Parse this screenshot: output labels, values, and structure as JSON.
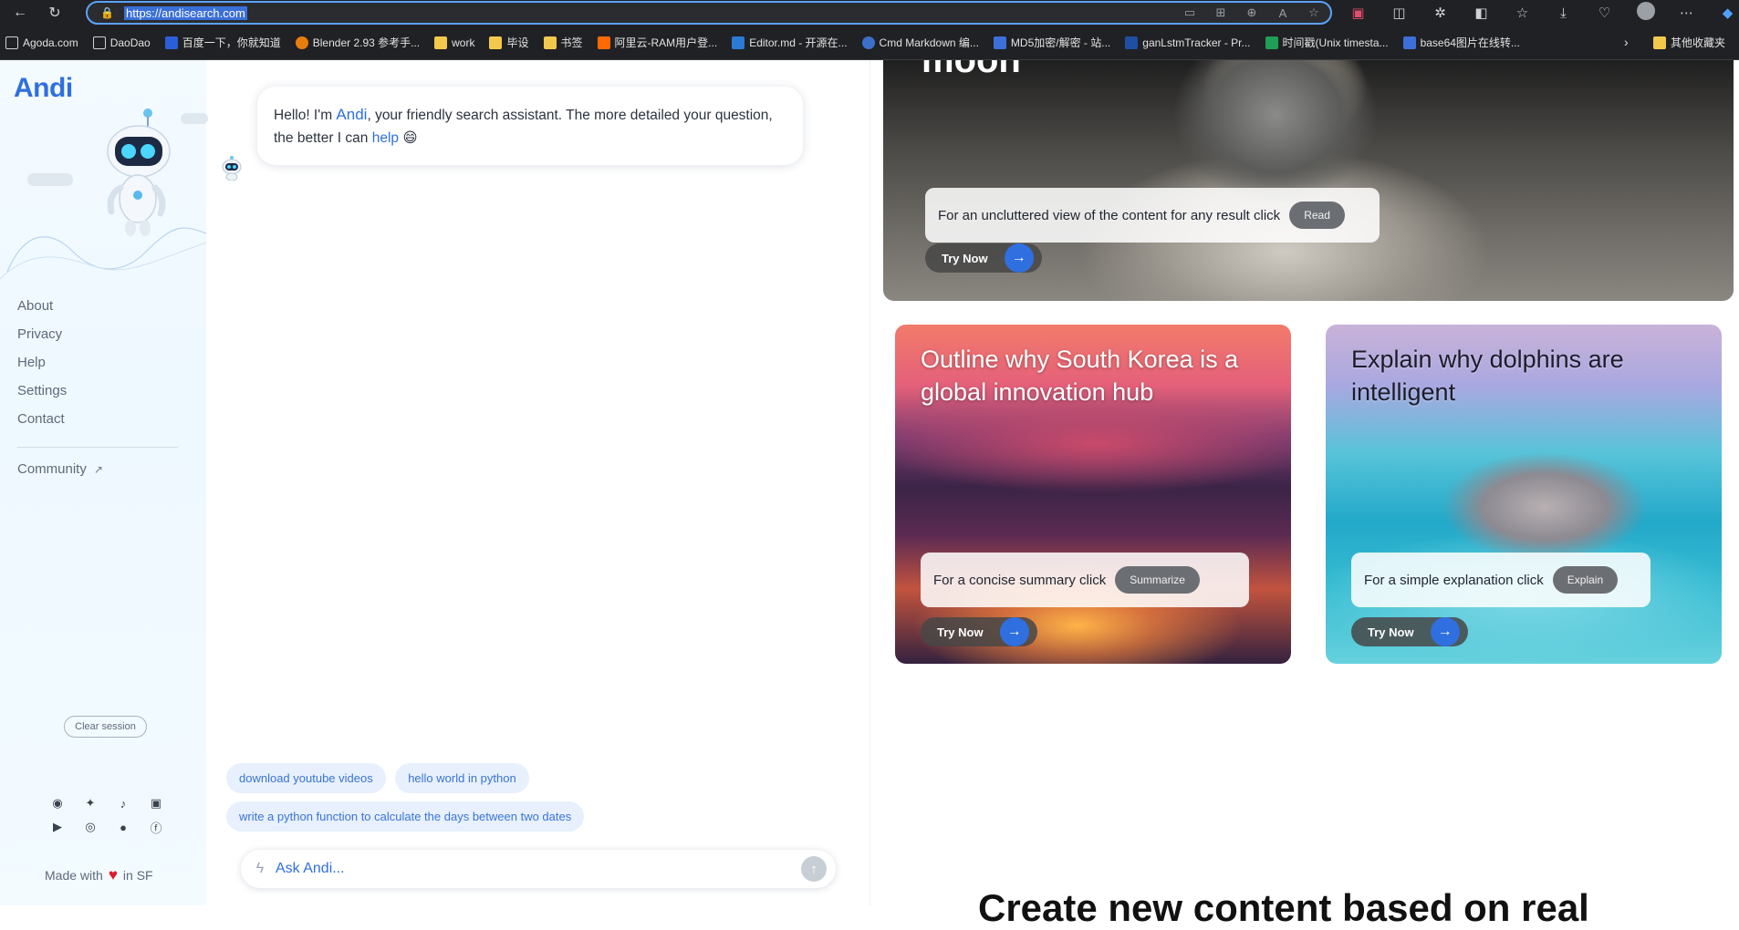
{
  "browser": {
    "url": "https://andisearch.com",
    "nav_icons": [
      "back-arrow",
      "reload"
    ],
    "url_action_icons": [
      "reader-mode",
      "apps",
      "add-tab",
      "read-aloud",
      "favorite-star"
    ],
    "toolbar_icons": [
      "translate-ext",
      "screenshot-ext",
      "extension-puzzle",
      "split-screen",
      "collections",
      "downloads",
      "health",
      "profile",
      "more"
    ],
    "bookmarks": [
      {
        "label": "Agoda.com",
        "icon": "page"
      },
      {
        "label": "DaoDao",
        "icon": "page"
      },
      {
        "label": "百度一下，你就知道",
        "icon": "baidu"
      },
      {
        "label": "Blender 2.93 参考手...",
        "icon": "blender"
      },
      {
        "label": "work",
        "icon": "folder"
      },
      {
        "label": "毕设",
        "icon": "folder"
      },
      {
        "label": "书签",
        "icon": "folder"
      },
      {
        "label": "阿里云-RAM用户登...",
        "icon": "aliyun"
      },
      {
        "label": "Editor.md - 开源在...",
        "icon": "editor"
      },
      {
        "label": "Cmd Markdown 编...",
        "icon": "cmd"
      },
      {
        "label": "MD5加密/解密 - 站...",
        "icon": "md5"
      },
      {
        "label": "ganLstmTracker - Pr...",
        "icon": "on"
      },
      {
        "label": "时间戳(Unix timesta...",
        "icon": "t"
      },
      {
        "label": "base64图片在线转...",
        "icon": "b64"
      }
    ],
    "bookmarks_more": "›",
    "other_bookmarks": "其他收藏夹"
  },
  "sidebar": {
    "logo": "Andi",
    "nav": [
      "About",
      "Privacy",
      "Help",
      "Settings",
      "Contact"
    ],
    "community": "Community",
    "clear_session": "Clear session",
    "social_icons": [
      "discord",
      "twitter",
      "tiktok",
      "linkedin",
      "youtube",
      "instagram",
      "reddit",
      "facebook"
    ],
    "made_with_prefix": "Made with",
    "made_with_suffix": "in SF"
  },
  "chat": {
    "greeting_pre": "Hello! I'm ",
    "greeting_brand": "Andi",
    "greeting_mid": ", your friendly search assistant. The more detailed your question, the better I can ",
    "greeting_link": "help",
    "greeting_emoji": "😄",
    "suggestions": [
      "download youtube videos",
      "hello world in python",
      "write a python function to calculate the days between two dates"
    ],
    "ask_placeholder": "Ask Andi..."
  },
  "cards": {
    "moon": {
      "title": "moon",
      "hint": "For an uncluttered view of the content for any result click",
      "pill": "Read",
      "try": "Try Now"
    },
    "korea": {
      "title": "Outline why South Korea is a global innovation hub",
      "hint": "For a concise summary click",
      "pill": "Summarize",
      "try": "Try Now"
    },
    "dolphin": {
      "title": "Explain why dolphins are intelligent",
      "hint": "For a simple explanation click",
      "pill": "Explain",
      "try": "Try Now"
    }
  },
  "bottom_heading": "Create new content based on real"
}
